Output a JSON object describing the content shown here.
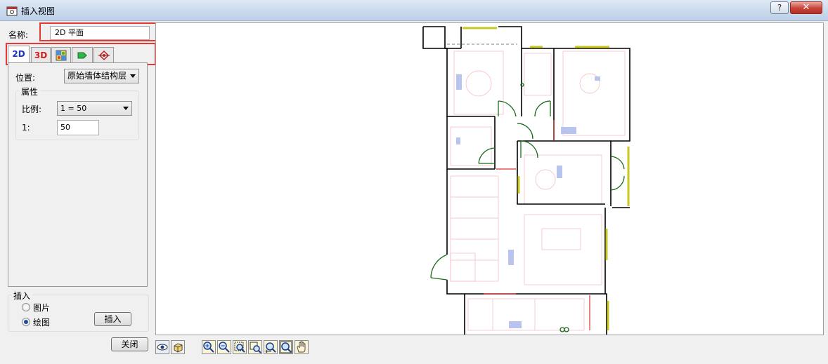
{
  "window": {
    "title": "插入视图",
    "help_label": "?",
    "close_label": "✕"
  },
  "form": {
    "name_label": "名称:",
    "name_value": "2D 平面"
  },
  "tabs": [
    {
      "label": "2D",
      "active": true
    },
    {
      "label": "3D",
      "active": false
    },
    {
      "icon": "texture-grid-icon"
    },
    {
      "icon": "green-arrow-icon"
    },
    {
      "icon": "elevation-marker-icon"
    }
  ],
  "properties": {
    "position_label": "位置:",
    "position_value": "原始墙体结构层",
    "group_title": "属性",
    "scale_label": "比例:",
    "scale_value": "1 = 50",
    "ratio_label": "1:",
    "ratio_value": "50"
  },
  "insert": {
    "group_title": "插入",
    "option_picture": "图片",
    "option_drawing": "绘图",
    "selected": "绘图",
    "insert_button": "插入"
  },
  "footer": {
    "close_button": "关闭"
  },
  "toolbar": {
    "icons": [
      "eye-icon",
      "3d-box-icon",
      "zoom-in-icon",
      "zoom-out-icon",
      "zoom-window-icon",
      "zoom-extents-icon",
      "zoom-previous-icon",
      "zoom-all-icon",
      "pan-hand-icon"
    ]
  },
  "colors": {
    "accent_red": "#e53935",
    "tab_2d": "#1636c8",
    "tab_3d": "#d02020",
    "canvas_bg": "#ffffff"
  }
}
